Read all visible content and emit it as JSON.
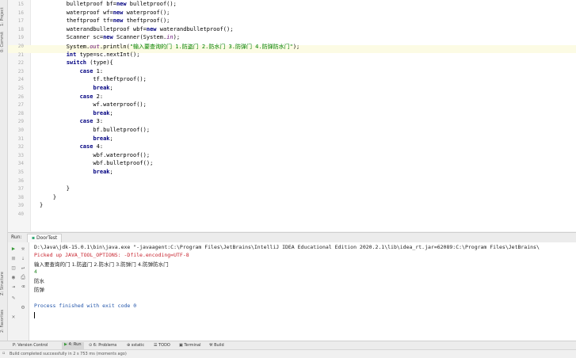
{
  "left_strip": {
    "project": "1: Project",
    "commit": "0: Commit",
    "structure": "Z: Structure",
    "favorites": "2: Favorites"
  },
  "editor": {
    "lines": [
      {
        "n": "15",
        "code": "        bulletproof bf=new bulletproof();"
      },
      {
        "n": "16",
        "code": "        waterproof wf=new waterproof();"
      },
      {
        "n": "17",
        "code": "        theftproof tf=new theftproof();"
      },
      {
        "n": "18",
        "code": "        waterandbulletproof wbf=new waterandbulletproof();"
      },
      {
        "n": "19",
        "code": "        Scanner sc=new Scanner(System.in);"
      },
      {
        "n": "20",
        "code": "        System.out.println(\"输入要查询的门 1.防盗门 2.防水门 3.防弹门 4.防弹防水门\");"
      },
      {
        "n": "21",
        "code": "        int type=sc.nextInt();"
      },
      {
        "n": "22",
        "code": "        switch (type){"
      },
      {
        "n": "23",
        "code": "            case 1:"
      },
      {
        "n": "24",
        "code": "                tf.theftproof();"
      },
      {
        "n": "25",
        "code": "                break;"
      },
      {
        "n": "26",
        "code": "            case 2:"
      },
      {
        "n": "27",
        "code": "                wf.waterproof();"
      },
      {
        "n": "28",
        "code": "                break;"
      },
      {
        "n": "29",
        "code": "            case 3:"
      },
      {
        "n": "30",
        "code": "                bf.bulletproof();"
      },
      {
        "n": "31",
        "code": "                break;"
      },
      {
        "n": "32",
        "code": "            case 4:"
      },
      {
        "n": "33",
        "code": "                wbf.waterproof();"
      },
      {
        "n": "34",
        "code": "                wbf.bulletproof();"
      },
      {
        "n": "35",
        "code": "                break;"
      },
      {
        "n": "36",
        "code": ""
      },
      {
        "n": "37",
        "code": "        }"
      },
      {
        "n": "38",
        "code": "    }"
      },
      {
        "n": "39",
        "code": "}"
      },
      {
        "n": "40",
        "code": ""
      }
    ]
  },
  "run_panel": {
    "label": "Run:",
    "tab": "DoorTest"
  },
  "console": {
    "cmd": "D:\\Java\\jdk-15.0.1\\bin\\java.exe \"-javaagent:C:\\Program Files\\JetBrains\\IntelliJ IDEA Educational Edition 2020.2.1\\lib\\idea_rt.jar=62089:C:\\Program Files\\JetBrains\\",
    "options": "Picked up JAVA_TOOL_OPTIONS: -Dfile.encoding=UTF-8",
    "prompt": "输入要查询的门 1.防盗门 2.防水门 3.防弹门 4.防弹防水门",
    "input": "4",
    "out1": "防水",
    "out2": "防弹",
    "finished": "Process finished with exit code 0"
  },
  "bottom_tabs": [
    "P: Version Control",
    "4: Run",
    "6: Problems",
    "sstatic",
    "TODO",
    "Terminal",
    "Build"
  ],
  "status": "Build completed successfully in 2 s 753 ms (moments ago)",
  "colors": {
    "keyword": "#000080",
    "string": "#008000",
    "error": "#c7222d",
    "input": "#2a8a2a",
    "finished": "#2255aa"
  }
}
